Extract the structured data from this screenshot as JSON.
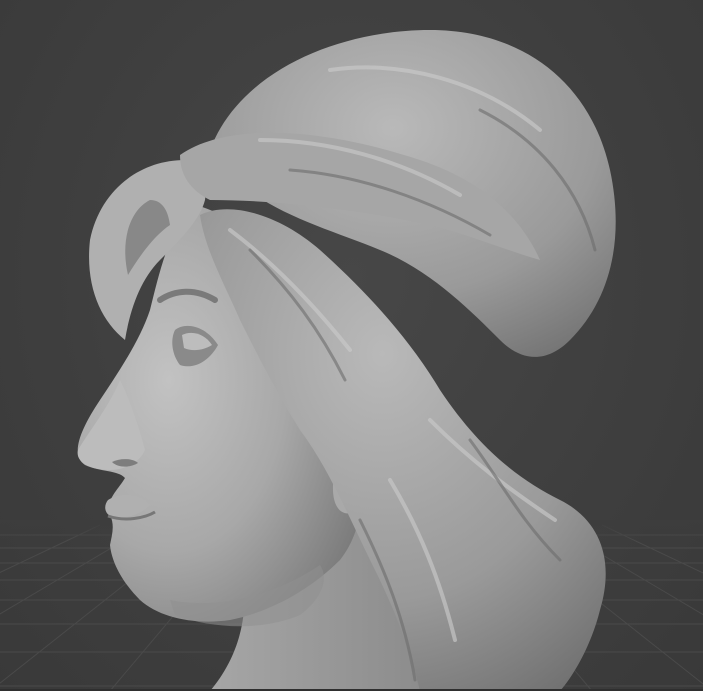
{
  "viewport": {
    "background_color": "#3d3d3d",
    "grid_line_color": "#4a4a4a",
    "mesh_base_color": "#9c9c9c",
    "mesh_highlight_color": "#c4c4c4",
    "mesh_shadow_color": "#5e5e5e",
    "display_mode": "solid",
    "subject": "sculpted-head-bust"
  }
}
